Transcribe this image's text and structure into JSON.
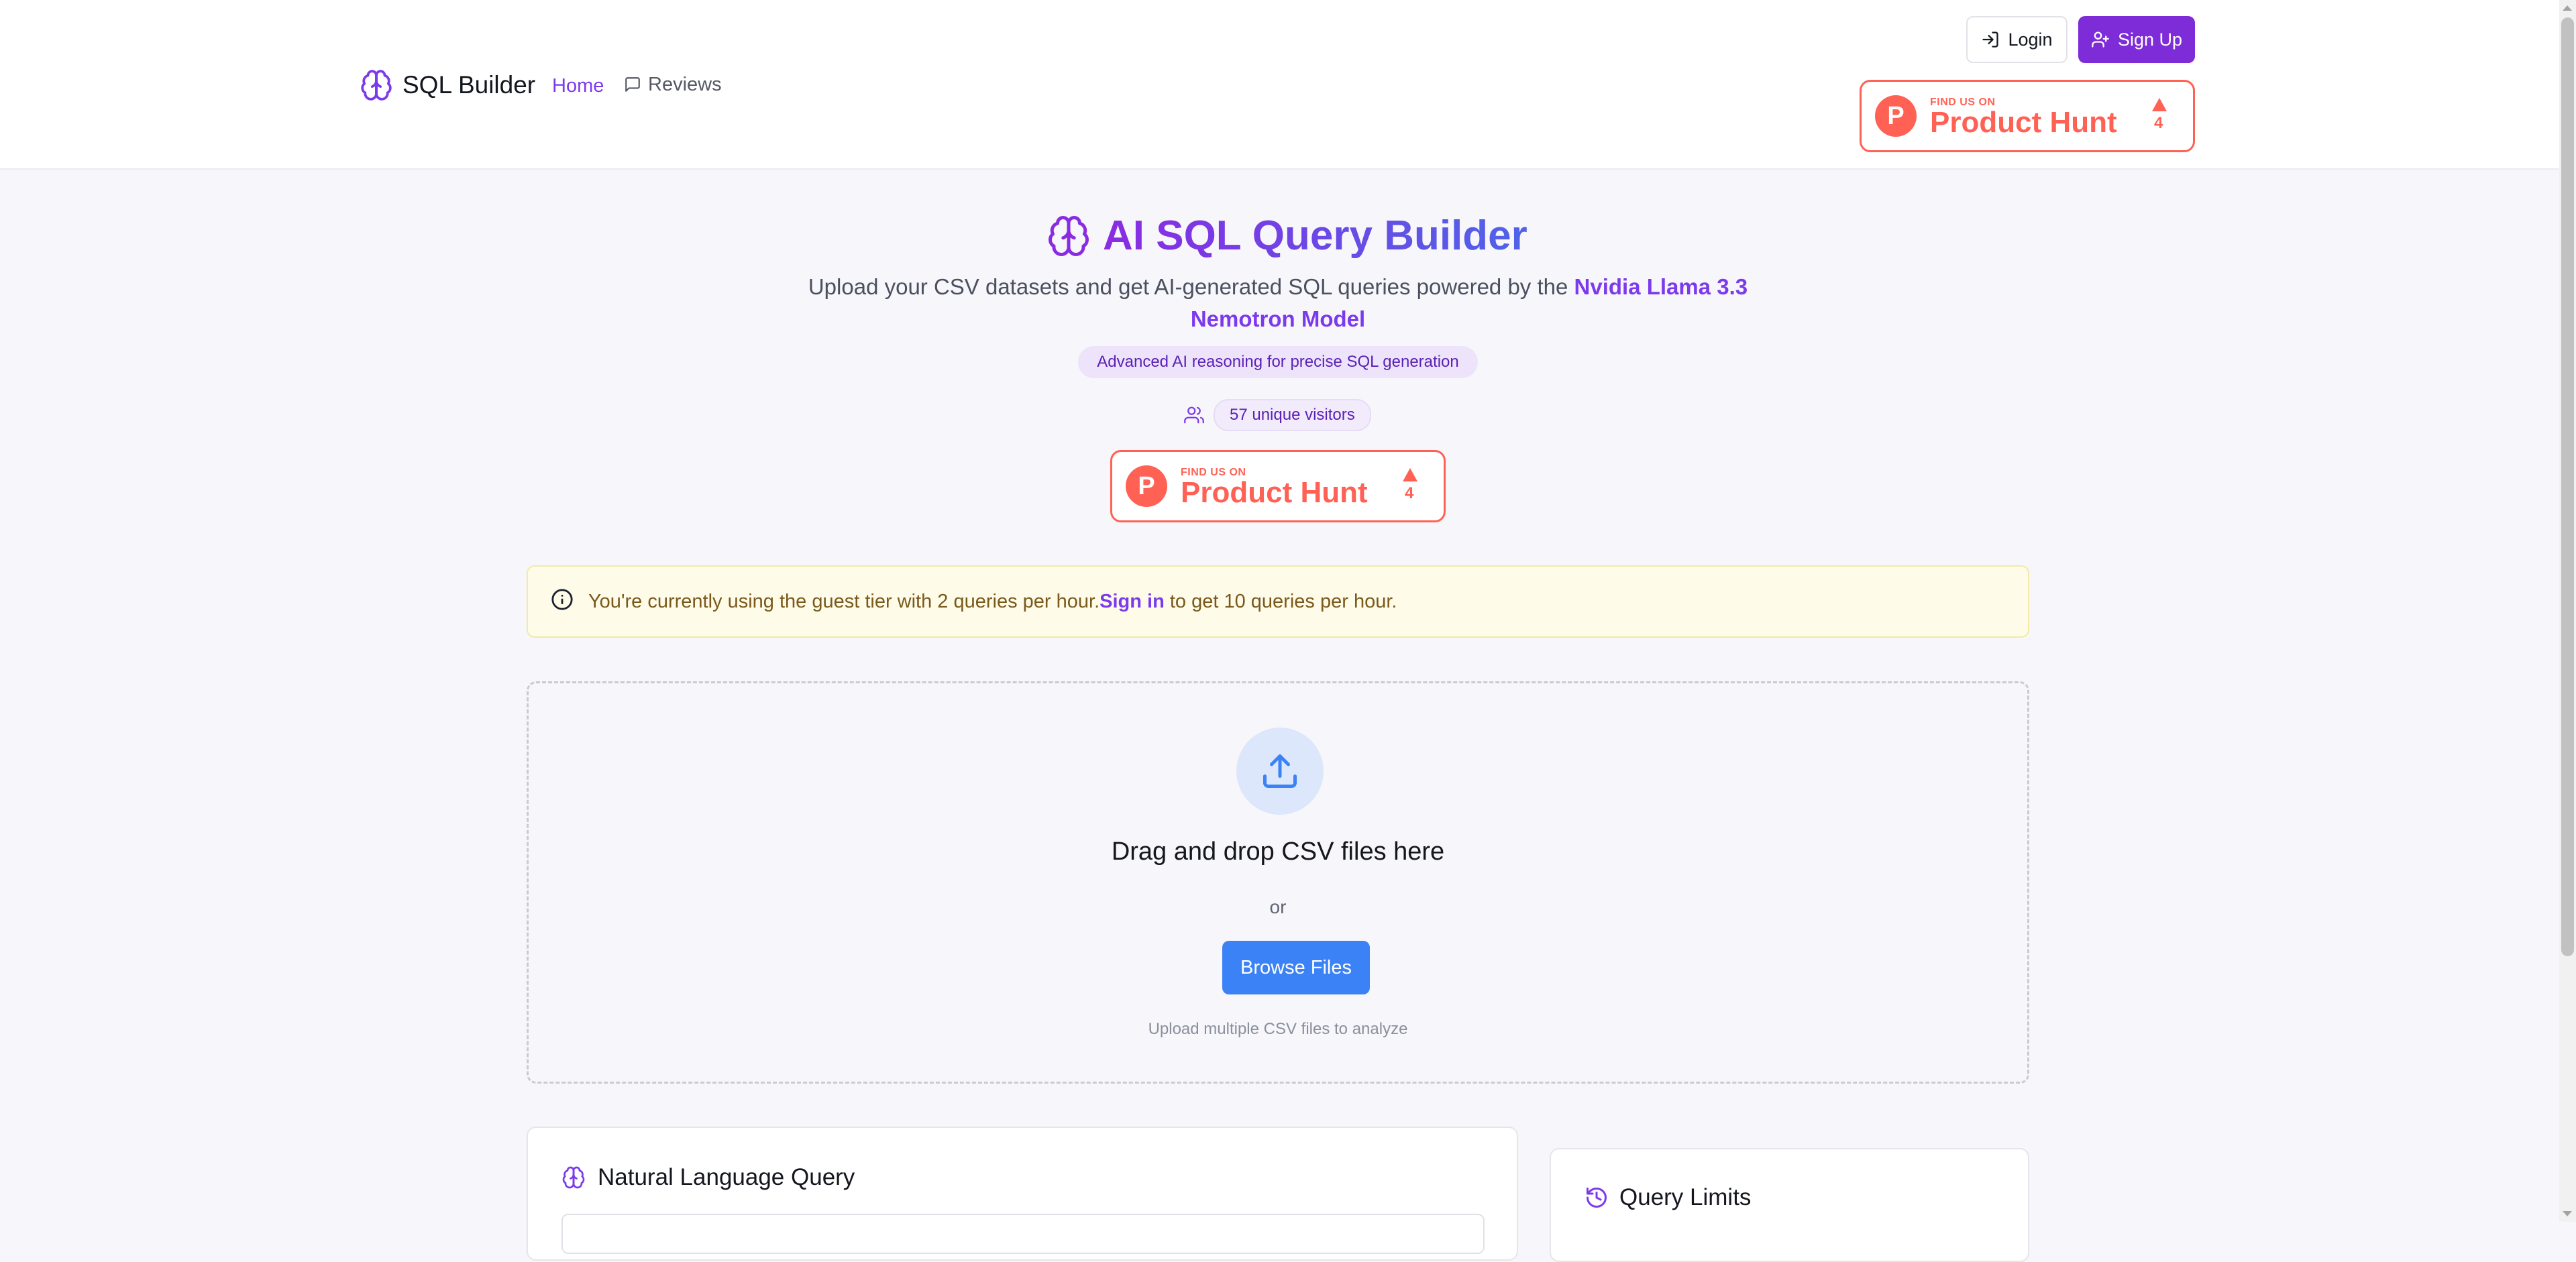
{
  "header": {
    "logo_text": "SQL Builder",
    "nav": [
      {
        "label": "Home",
        "active": true
      },
      {
        "label": "Reviews",
        "active": false
      }
    ],
    "login_label": "Login",
    "signup_label": "Sign Up",
    "product_hunt": {
      "small": "FIND US ON",
      "big": "Product Hunt",
      "logo_letter": "P",
      "upvotes": "4"
    }
  },
  "hero": {
    "title": "AI SQL Query Builder",
    "subtitle_prefix": "Upload your CSV datasets and get AI-generated SQL queries powered by the",
    "subtitle_highlight_1": "Nvidia Llama 3.3",
    "subtitle_highlight_2": "Nemotron Model",
    "pill": "Advanced AI reasoning for precise SQL generation",
    "visitors": "57 unique visitors",
    "product_hunt": {
      "small": "FIND US ON",
      "big": "Product Hunt",
      "logo_letter": "P",
      "upvotes": "4"
    }
  },
  "notice": {
    "prefix": "You're currently using the guest tier with 2 queries per hour.",
    "link": "Sign in",
    "suffix": " to get 10 queries per hour."
  },
  "upload": {
    "title": "Drag and drop CSV files here",
    "or": "or",
    "button": "Browse Files",
    "hint": "Upload multiple CSV files to analyze"
  },
  "cards": {
    "natural_language_title": "Natural Language Query",
    "query_limits_title": "Query Limits"
  },
  "colors": {
    "accent": "#7c3aed",
    "primary_button": "#3b82f6",
    "product_hunt": "#ff6154",
    "notice_bg": "#fefbe8"
  }
}
